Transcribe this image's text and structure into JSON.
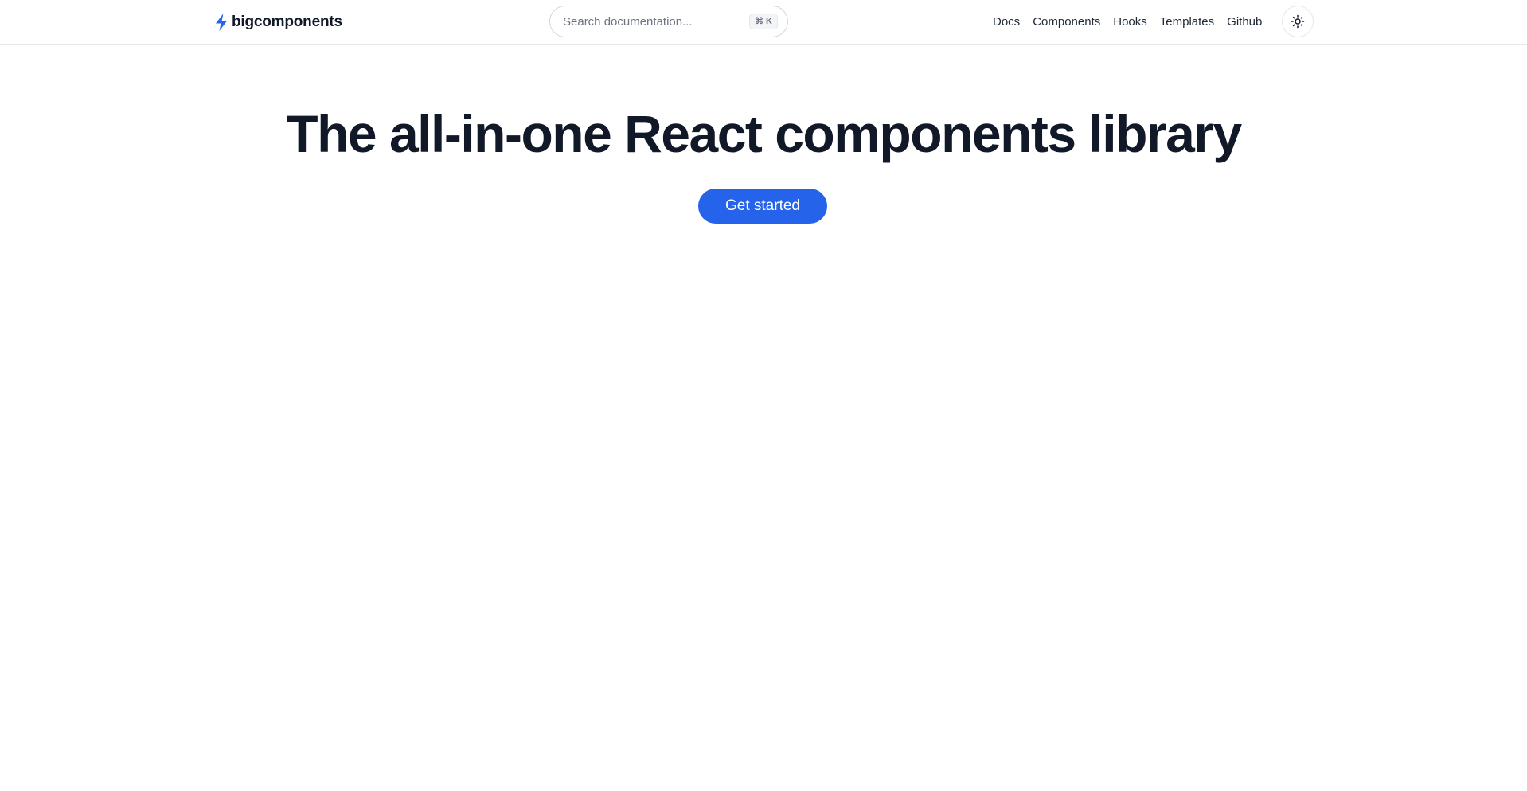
{
  "header": {
    "brand_name": "bigcomponents",
    "brand_icon": "lightning-bolt-icon",
    "search": {
      "placeholder": "Search documentation...",
      "shortcut": "⌘ K"
    },
    "nav": [
      {
        "label": "Docs"
      },
      {
        "label": "Components"
      },
      {
        "label": "Hooks"
      },
      {
        "label": "Templates"
      },
      {
        "label": "Github"
      }
    ],
    "theme_toggle_icon": "sun-icon"
  },
  "hero": {
    "title": "The all-in-one React components library",
    "cta_label": "Get started"
  },
  "colors": {
    "accent": "#2563eb",
    "text": "#111827",
    "border": "#e5e7eb"
  }
}
